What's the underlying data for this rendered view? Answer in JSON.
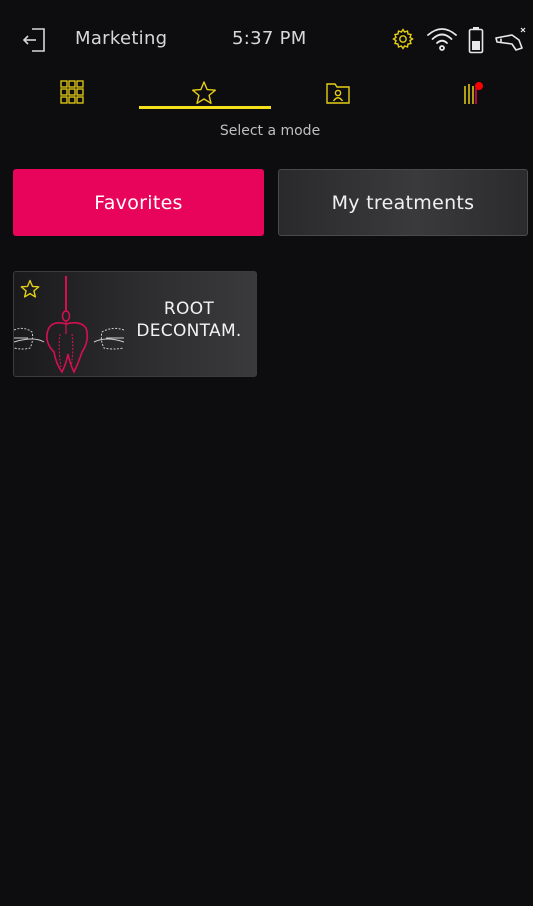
{
  "status": {
    "user_name": "Marketing",
    "time": "5:37 PM",
    "icons": [
      "exit-icon",
      "gear-icon",
      "wifi-icon",
      "battery-icon",
      "handpiece-icon"
    ]
  },
  "tabs": [
    {
      "name": "grid",
      "icon": "grid-icon"
    },
    {
      "name": "favorites",
      "icon": "star-icon",
      "active": true
    },
    {
      "name": "patient-folder",
      "icon": "folder-user-icon"
    },
    {
      "name": "settings",
      "icon": "levels-icon"
    }
  ],
  "subtitle": "Select a mode",
  "mode_toggle": {
    "favorites_label": "Favorites",
    "my_treatments_label": "My treatments",
    "selected": "Favorites"
  },
  "cards": [
    {
      "line1": "ROOT",
      "line2": "DECONTAM.",
      "icon": "tooth-root-icon",
      "favorite": true
    }
  ],
  "colors": {
    "background": "#0d0c0f",
    "accent_pink": "#e8045a",
    "accent_yellow": "#f3df1c",
    "notify_red": "#ff0000"
  }
}
